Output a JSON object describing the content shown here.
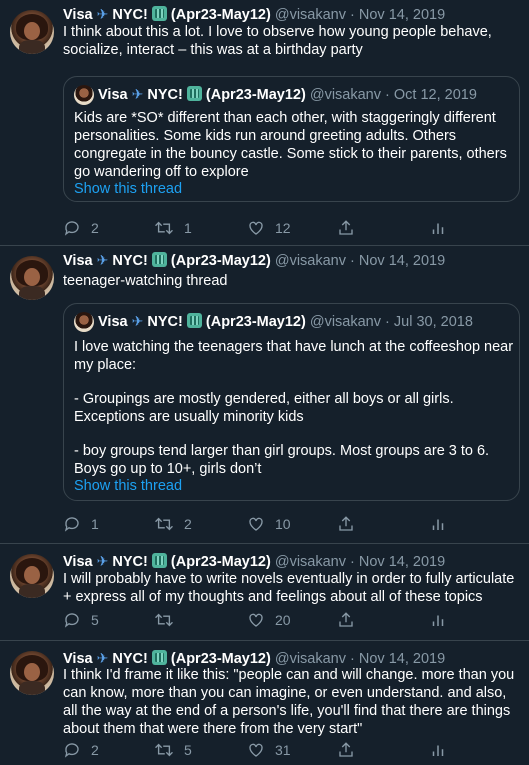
{
  "tweets": [
    {
      "name": "Visa",
      "name_suffix": "NYC!",
      "name_dates": "(Apr23-May12)",
      "handle": "@visakanv",
      "date": "Nov 14, 2019",
      "text": "I think about this a lot. I love to observe how young people behave, socialize, interact – this was at a birthday party",
      "quote": {
        "name": "Visa",
        "name_suffix": "NYC!",
        "name_dates": "(Apr23-May12)",
        "handle": "@visakanv",
        "date": "Oct 12, 2019",
        "text": "Kids are *SO* different than each other, with staggeringly different personalities. Some kids run around greeting adults. Others congregate in the bouncy castle. Some stick to their parents, others go wandering off to explore",
        "link": "Show this thread"
      },
      "replies": "2",
      "retweets": "1",
      "likes": "12"
    },
    {
      "name": "Visa",
      "name_suffix": "NYC!",
      "name_dates": "(Apr23-May12)",
      "handle": "@visakanv",
      "date": "Nov 14, 2019",
      "text": "teenager-watching thread",
      "quote": {
        "name": "Visa",
        "name_suffix": "NYC!",
        "name_dates": "(Apr23-May12)",
        "handle": "@visakanv",
        "date": "Jul 30, 2018",
        "text1": "I love watching the teenagers that have lunch at the coffeeshop near my place:",
        "text2": "- Groupings are mostly gendered, either all boys or all girls. Exceptions are usually minority kids",
        "text3": "- boy groups tend larger than girl groups. Most groups are 3 to 6. Boys go up to 10+, girls don’t",
        "link": "Show this thread"
      },
      "replies": "1",
      "retweets": "2",
      "likes": "10"
    },
    {
      "name": "Visa",
      "name_suffix": "NYC!",
      "name_dates": "(Apr23-May12)",
      "handle": "@visakanv",
      "date": "Nov 14, 2019",
      "text": "I will probably have to write novels eventually in order to fully articulate + express all of my thoughts and feelings about all of these topics",
      "replies": "5",
      "retweets": "",
      "likes": "20"
    },
    {
      "name": "Visa",
      "name_suffix": "NYC!",
      "name_dates": "(Apr23-May12)",
      "handle": "@visakanv",
      "date": "Nov 14, 2019",
      "text": "I think I'd frame it like this: \"people can and will change. more than you can know, more than you can imagine, or even understand. and also, all the way at the end of a person's life, you'll find that there are things about them that were there from the very start\"",
      "replies": "2",
      "retweets": "5",
      "likes": "31"
    }
  ],
  "icons": {
    "reply": "reply-icon",
    "retweet": "retweet-icon",
    "like": "heart-icon",
    "share": "share-icon",
    "analytics": "analytics-icon"
  },
  "colors": {
    "background": "#15202b",
    "muted": "#8899a6",
    "link": "#1da1f2",
    "border": "#38444d"
  }
}
